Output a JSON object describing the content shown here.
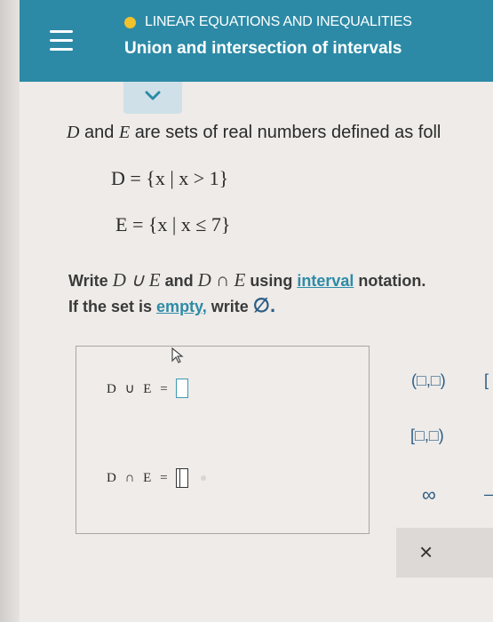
{
  "header": {
    "menu_icon": "hamburger-menu-icon",
    "topic": "LINEAR EQUATIONS AND INEQUALITIES",
    "topic_status_color": "#f2c12e",
    "subtitle": "Union and intersection of intervals",
    "bar_color": "#2c8aa6"
  },
  "collapse": {
    "icon": "chevron-down-icon"
  },
  "problem": {
    "intro_set1": "D",
    "intro_and": "and",
    "intro_set2": "E",
    "intro_rest": "are sets of real numbers defined as foll",
    "def_d": "D = {x | x > 1}",
    "def_e": "E = {x | x ≤ 7}",
    "line1_a": "Write",
    "line1_expr1": "D ∪ E",
    "line1_and": "and",
    "line1_expr2": "D ∩ E",
    "line1_using": "using",
    "line1_link": "interval",
    "line1_end": "notation.",
    "line2_a": "If the set is",
    "line2_link": "empty,",
    "line2_b": "write",
    "line2_sym": "∅."
  },
  "answers": {
    "union_label": "D ∪ E =",
    "intersection_label": "D ∩ E ="
  },
  "palette": {
    "open_interval": "(□,□)",
    "closed_left": "[□,□)",
    "partial": "[",
    "infinity": "∞",
    "minus_partial": "–",
    "clear": "×"
  }
}
